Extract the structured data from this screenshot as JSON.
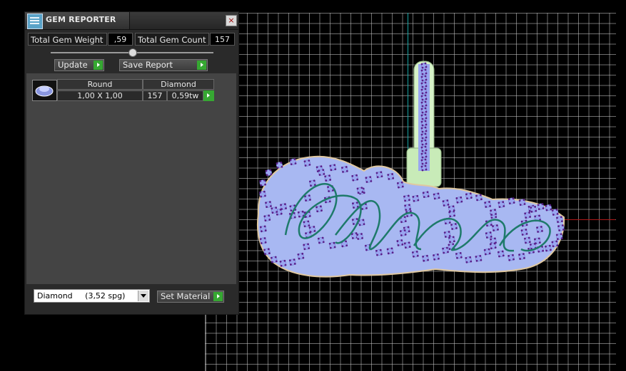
{
  "panel": {
    "title": "GEM REPORTER",
    "close_label": "×",
    "total_weight_label": "Total Gem Weight",
    "total_weight_value": ",59",
    "total_count_label": "Total Gem Count",
    "total_count_value": "157",
    "update_label": "Update",
    "save_report_label": "Save Report",
    "slider_fraction": 0.5
  },
  "gem_table": {
    "headers": [
      "Round",
      "Diamond"
    ],
    "rows": [
      {
        "size": "1,00 X 1,00",
        "count": "157",
        "weight": "0,59tw"
      }
    ]
  },
  "material": {
    "selected": "Diamond     (3,52 spg)",
    "set_label": "Set Material"
  },
  "colors": {
    "gem_blue": "#9aa6f0",
    "prong_purple": "#5a1f8a",
    "setting_green": "#cfeec0",
    "axis_cyan": "#1aa7a7",
    "axis_red": "#b01818",
    "accept_green": "#36a832"
  }
}
